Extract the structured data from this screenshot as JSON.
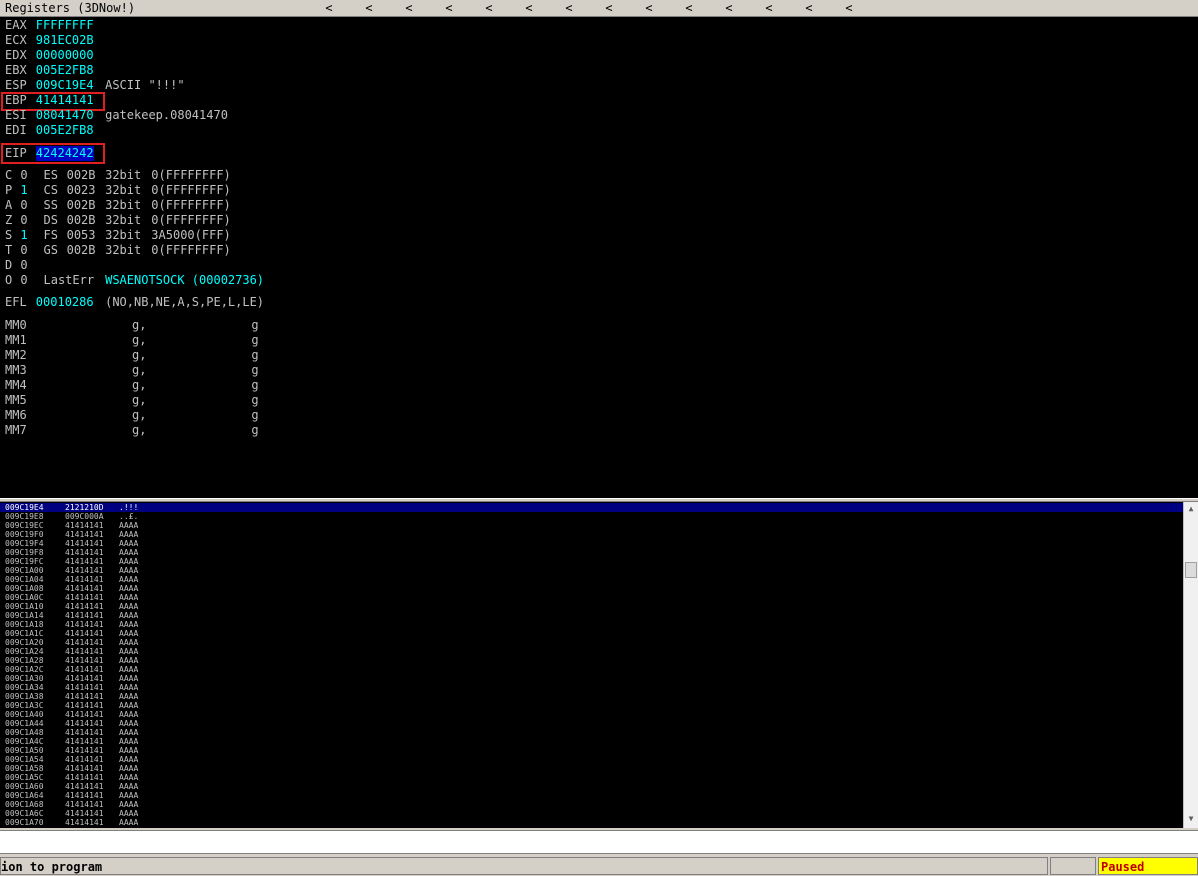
{
  "registers_pane": {
    "title": "Registers (3DNow!)",
    "gprs": [
      {
        "name": "EAX",
        "value": "FFFFFFFF",
        "comment": ""
      },
      {
        "name": "ECX",
        "value": "981EC02B",
        "comment": ""
      },
      {
        "name": "EDX",
        "value": "00000000",
        "comment": ""
      },
      {
        "name": "EBX",
        "value": "005E2FB8",
        "comment": ""
      },
      {
        "name": "ESP",
        "value": "009C19E4",
        "comment": "ASCII \"!!!\""
      },
      {
        "name": "EBP",
        "value": "41414141",
        "comment": ""
      },
      {
        "name": "ESI",
        "value": "08041470",
        "comment": "gatekeep.08041470"
      },
      {
        "name": "EDI",
        "value": "005E2FB8",
        "comment": ""
      }
    ],
    "eip": {
      "name": "EIP",
      "value": "42424242"
    },
    "flags": [
      {
        "flag": "C",
        "val": "0",
        "seg": "ES",
        "sel": "002B",
        "bits": "32bit",
        "base": "0(FFFFFFFF)"
      },
      {
        "flag": "P",
        "val": "1",
        "seg": "CS",
        "sel": "0023",
        "bits": "32bit",
        "base": "0(FFFFFFFF)"
      },
      {
        "flag": "A",
        "val": "0",
        "seg": "SS",
        "sel": "002B",
        "bits": "32bit",
        "base": "0(FFFFFFFF)"
      },
      {
        "flag": "Z",
        "val": "0",
        "seg": "DS",
        "sel": "002B",
        "bits": "32bit",
        "base": "0(FFFFFFFF)"
      },
      {
        "flag": "S",
        "val": "1",
        "seg": "FS",
        "sel": "0053",
        "bits": "32bit",
        "base": "3A5000(FFF)"
      },
      {
        "flag": "T",
        "val": "0",
        "seg": "GS",
        "sel": "002B",
        "bits": "32bit",
        "base": "0(FFFFFFFF)"
      },
      {
        "flag": "D",
        "val": "0",
        "seg": "",
        "sel": "",
        "bits": "",
        "base": ""
      },
      {
        "flag": "O",
        "val": "0",
        "seg": "",
        "sel": "",
        "bits": "",
        "base": ""
      }
    ],
    "lasterr": {
      "label": "LastErr",
      "value": "WSAENOTSOCK (00002736)"
    },
    "efl": {
      "label": "EFL",
      "value": "00010286",
      "desc": "(NO,NB,NE,A,S,PE,L,LE)"
    },
    "mmx": [
      {
        "name": "MM0",
        "a": "g,",
        "b": "g"
      },
      {
        "name": "MM1",
        "a": "g,",
        "b": "g"
      },
      {
        "name": "MM2",
        "a": "g,",
        "b": "g"
      },
      {
        "name": "MM3",
        "a": "g,",
        "b": "g"
      },
      {
        "name": "MM4",
        "a": "g,",
        "b": "g"
      },
      {
        "name": "MM5",
        "a": "g,",
        "b": "g"
      },
      {
        "name": "MM6",
        "a": "g,",
        "b": "g"
      },
      {
        "name": "MM7",
        "a": "g,",
        "b": "g"
      }
    ]
  },
  "stack_pane": {
    "rows": [
      {
        "addr": "009C19E4",
        "value": "2121210D",
        "ascii": ".!!!",
        "selected": true
      },
      {
        "addr": "009C19E8",
        "value": "009C000A",
        "ascii": "..£.",
        "selected": false
      },
      {
        "addr": "009C19EC",
        "value": "41414141",
        "ascii": "AAAA",
        "selected": false
      },
      {
        "addr": "009C19F0",
        "value": "41414141",
        "ascii": "AAAA",
        "selected": false
      },
      {
        "addr": "009C19F4",
        "value": "41414141",
        "ascii": "AAAA",
        "selected": false
      },
      {
        "addr": "009C19F8",
        "value": "41414141",
        "ascii": "AAAA",
        "selected": false
      },
      {
        "addr": "009C19FC",
        "value": "41414141",
        "ascii": "AAAA",
        "selected": false
      },
      {
        "addr": "009C1A00",
        "value": "41414141",
        "ascii": "AAAA",
        "selected": false
      },
      {
        "addr": "009C1A04",
        "value": "41414141",
        "ascii": "AAAA",
        "selected": false
      },
      {
        "addr": "009C1A08",
        "value": "41414141",
        "ascii": "AAAA",
        "selected": false
      },
      {
        "addr": "009C1A0C",
        "value": "41414141",
        "ascii": "AAAA",
        "selected": false
      },
      {
        "addr": "009C1A10",
        "value": "41414141",
        "ascii": "AAAA",
        "selected": false
      },
      {
        "addr": "009C1A14",
        "value": "41414141",
        "ascii": "AAAA",
        "selected": false
      },
      {
        "addr": "009C1A18",
        "value": "41414141",
        "ascii": "AAAA",
        "selected": false
      },
      {
        "addr": "009C1A1C",
        "value": "41414141",
        "ascii": "AAAA",
        "selected": false
      },
      {
        "addr": "009C1A20",
        "value": "41414141",
        "ascii": "AAAA",
        "selected": false
      },
      {
        "addr": "009C1A24",
        "value": "41414141",
        "ascii": "AAAA",
        "selected": false
      },
      {
        "addr": "009C1A28",
        "value": "41414141",
        "ascii": "AAAA",
        "selected": false
      },
      {
        "addr": "009C1A2C",
        "value": "41414141",
        "ascii": "AAAA",
        "selected": false
      },
      {
        "addr": "009C1A30",
        "value": "41414141",
        "ascii": "AAAA",
        "selected": false
      },
      {
        "addr": "009C1A34",
        "value": "41414141",
        "ascii": "AAAA",
        "selected": false
      },
      {
        "addr": "009C1A38",
        "value": "41414141",
        "ascii": "AAAA",
        "selected": false
      },
      {
        "addr": "009C1A3C",
        "value": "41414141",
        "ascii": "AAAA",
        "selected": false
      },
      {
        "addr": "009C1A40",
        "value": "41414141",
        "ascii": "AAAA",
        "selected": false
      },
      {
        "addr": "009C1A44",
        "value": "41414141",
        "ascii": "AAAA",
        "selected": false
      },
      {
        "addr": "009C1A48",
        "value": "41414141",
        "ascii": "AAAA",
        "selected": false
      },
      {
        "addr": "009C1A4C",
        "value": "41414141",
        "ascii": "AAAA",
        "selected": false
      },
      {
        "addr": "009C1A50",
        "value": "41414141",
        "ascii": "AAAA",
        "selected": false
      },
      {
        "addr": "009C1A54",
        "value": "41414141",
        "ascii": "AAAA",
        "selected": false
      },
      {
        "addr": "009C1A58",
        "value": "41414141",
        "ascii": "AAAA",
        "selected": false
      },
      {
        "addr": "009C1A5C",
        "value": "41414141",
        "ascii": "AAAA",
        "selected": false
      },
      {
        "addr": "009C1A60",
        "value": "41414141",
        "ascii": "AAAA",
        "selected": false
      },
      {
        "addr": "009C1A64",
        "value": "41414141",
        "ascii": "AAAA",
        "selected": false
      },
      {
        "addr": "009C1A68",
        "value": "41414141",
        "ascii": "AAAA",
        "selected": false
      },
      {
        "addr": "009C1A6C",
        "value": "41414141",
        "ascii": "AAAA",
        "selected": false
      },
      {
        "addr": "009C1A70",
        "value": "41414141",
        "ascii": "AAAA",
        "selected": false
      }
    ]
  },
  "command_line": {
    "value": ""
  },
  "status_bar": {
    "message": "ion to program",
    "state": "Paused"
  },
  "colors": {
    "register_value": "#00ffff",
    "highlight_box": "#e02020",
    "paused_bg": "#ffff00",
    "paused_text": "#c00000",
    "selected_row": "#000080"
  }
}
